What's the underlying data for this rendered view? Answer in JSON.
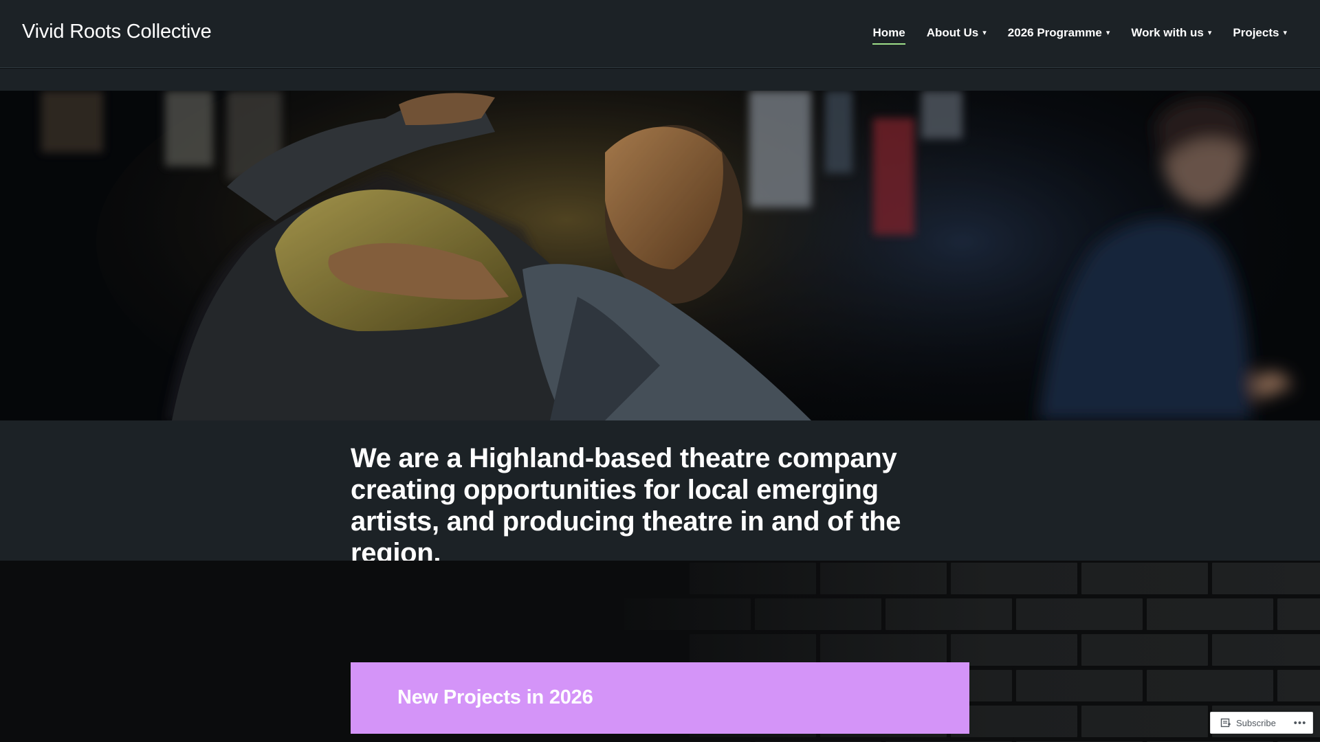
{
  "site": {
    "title": "Vivid Roots Collective"
  },
  "nav": {
    "items": [
      {
        "label": "Home",
        "active": true,
        "has_dropdown": false
      },
      {
        "label": "About Us",
        "active": false,
        "has_dropdown": true
      },
      {
        "label": "2026 Programme",
        "active": false,
        "has_dropdown": true
      },
      {
        "label": "Work with us",
        "active": false,
        "has_dropdown": true
      },
      {
        "label": "Projects",
        "active": false,
        "has_dropdown": true
      }
    ],
    "dropdown_icon": "▾"
  },
  "intro": {
    "text": "We are a Highland-based theatre company creating opportunities for local emerging artists, and producing theatre in and of the region."
  },
  "projects_banner": {
    "title": "New Projects in 2026",
    "color": "#d494f8"
  },
  "subscribe_widget": {
    "label": "Subscribe",
    "more_icon": "•••"
  },
  "colors": {
    "header_bg": "#1c2226",
    "active_underline": "#9fe08a",
    "page_bg": "#0b0c0d"
  }
}
